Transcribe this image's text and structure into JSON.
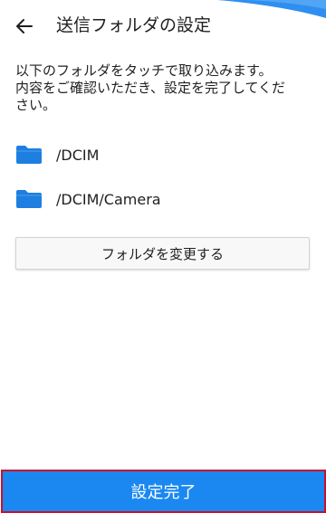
{
  "header": {
    "title": "送信フォルダの設定",
    "back_icon": "arrow-left-icon"
  },
  "description": {
    "lines": [
      "以下のフォルダをタッチで取り込みます。",
      "内容をご確認いただき、設定を完了してくだ",
      "さい。"
    ]
  },
  "folders": [
    {
      "icon": "folder-icon",
      "path": "/DCIM"
    },
    {
      "icon": "folder-icon",
      "path": "/DCIM/Camera"
    }
  ],
  "buttons": {
    "change_folder": "フォルダを変更する",
    "complete": "設定完了"
  },
  "colors": {
    "accent_blue": "#1a88f0",
    "folder_blue": "#1e7fe0",
    "highlight_border": "#c8102e"
  }
}
